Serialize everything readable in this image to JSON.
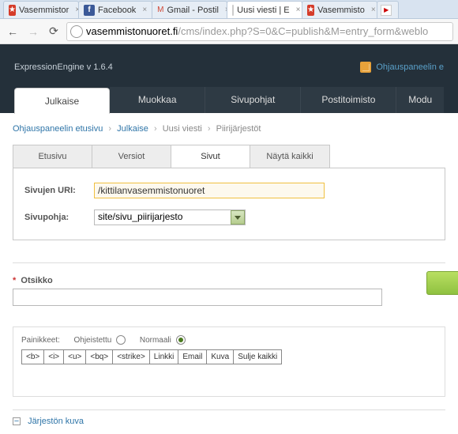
{
  "browser": {
    "tabs": [
      {
        "label": "Vasemmistor",
        "fav": "red"
      },
      {
        "label": "Facebook",
        "fav": "fb"
      },
      {
        "label": "Gmail - Postil",
        "fav": "gmail"
      },
      {
        "label": "Uusi viesti | E",
        "fav": "blank",
        "active": true
      },
      {
        "label": "Vasemmisto",
        "fav": "red"
      },
      {
        "label": "",
        "fav": "yt"
      }
    ],
    "url_host": "vasemmistonuoret.fi",
    "url_path": "/cms/index.php?S=0&C=publish&M=entry_form&weblo"
  },
  "header": {
    "engine": "ExpressionEngine  v 1.6.4",
    "help_link": "Ohjauspaneelin e"
  },
  "main_nav": {
    "items": [
      "Julkaise",
      "Muokkaa",
      "Sivupohjat",
      "Postitoimisto",
      "Modu"
    ],
    "active": 0
  },
  "breadcrumb": {
    "items": [
      "Ohjauspaneelin etusivu",
      "Julkaise",
      "Uusi viesti",
      "Piirijärjestöt"
    ],
    "links": [
      true,
      true,
      false,
      false
    ]
  },
  "subtabs": {
    "items": [
      "Etusivu",
      "Versiot",
      "Sivut",
      "Näytä kaikki"
    ],
    "active": 2
  },
  "pages": {
    "uri_label": "Sivujen URI:",
    "uri_value": "/kittilanvasemmistonuoret",
    "template_label": "Sivupohja:",
    "template_value": "site/sivu_piirijarjesto"
  },
  "title_field": {
    "label": "Otsikko",
    "value": ""
  },
  "editor": {
    "buttons_label": "Painikkeet:",
    "mode_guided": "Ohjeistettu",
    "mode_normal": "Normaali",
    "buttons": [
      "<b>",
      "<i>",
      "<u>",
      "<bq>",
      "<strike>",
      "Linkki",
      "Email",
      "Kuva",
      "Sulje kaikki"
    ]
  },
  "section": {
    "label": "Järjestön kuva"
  }
}
